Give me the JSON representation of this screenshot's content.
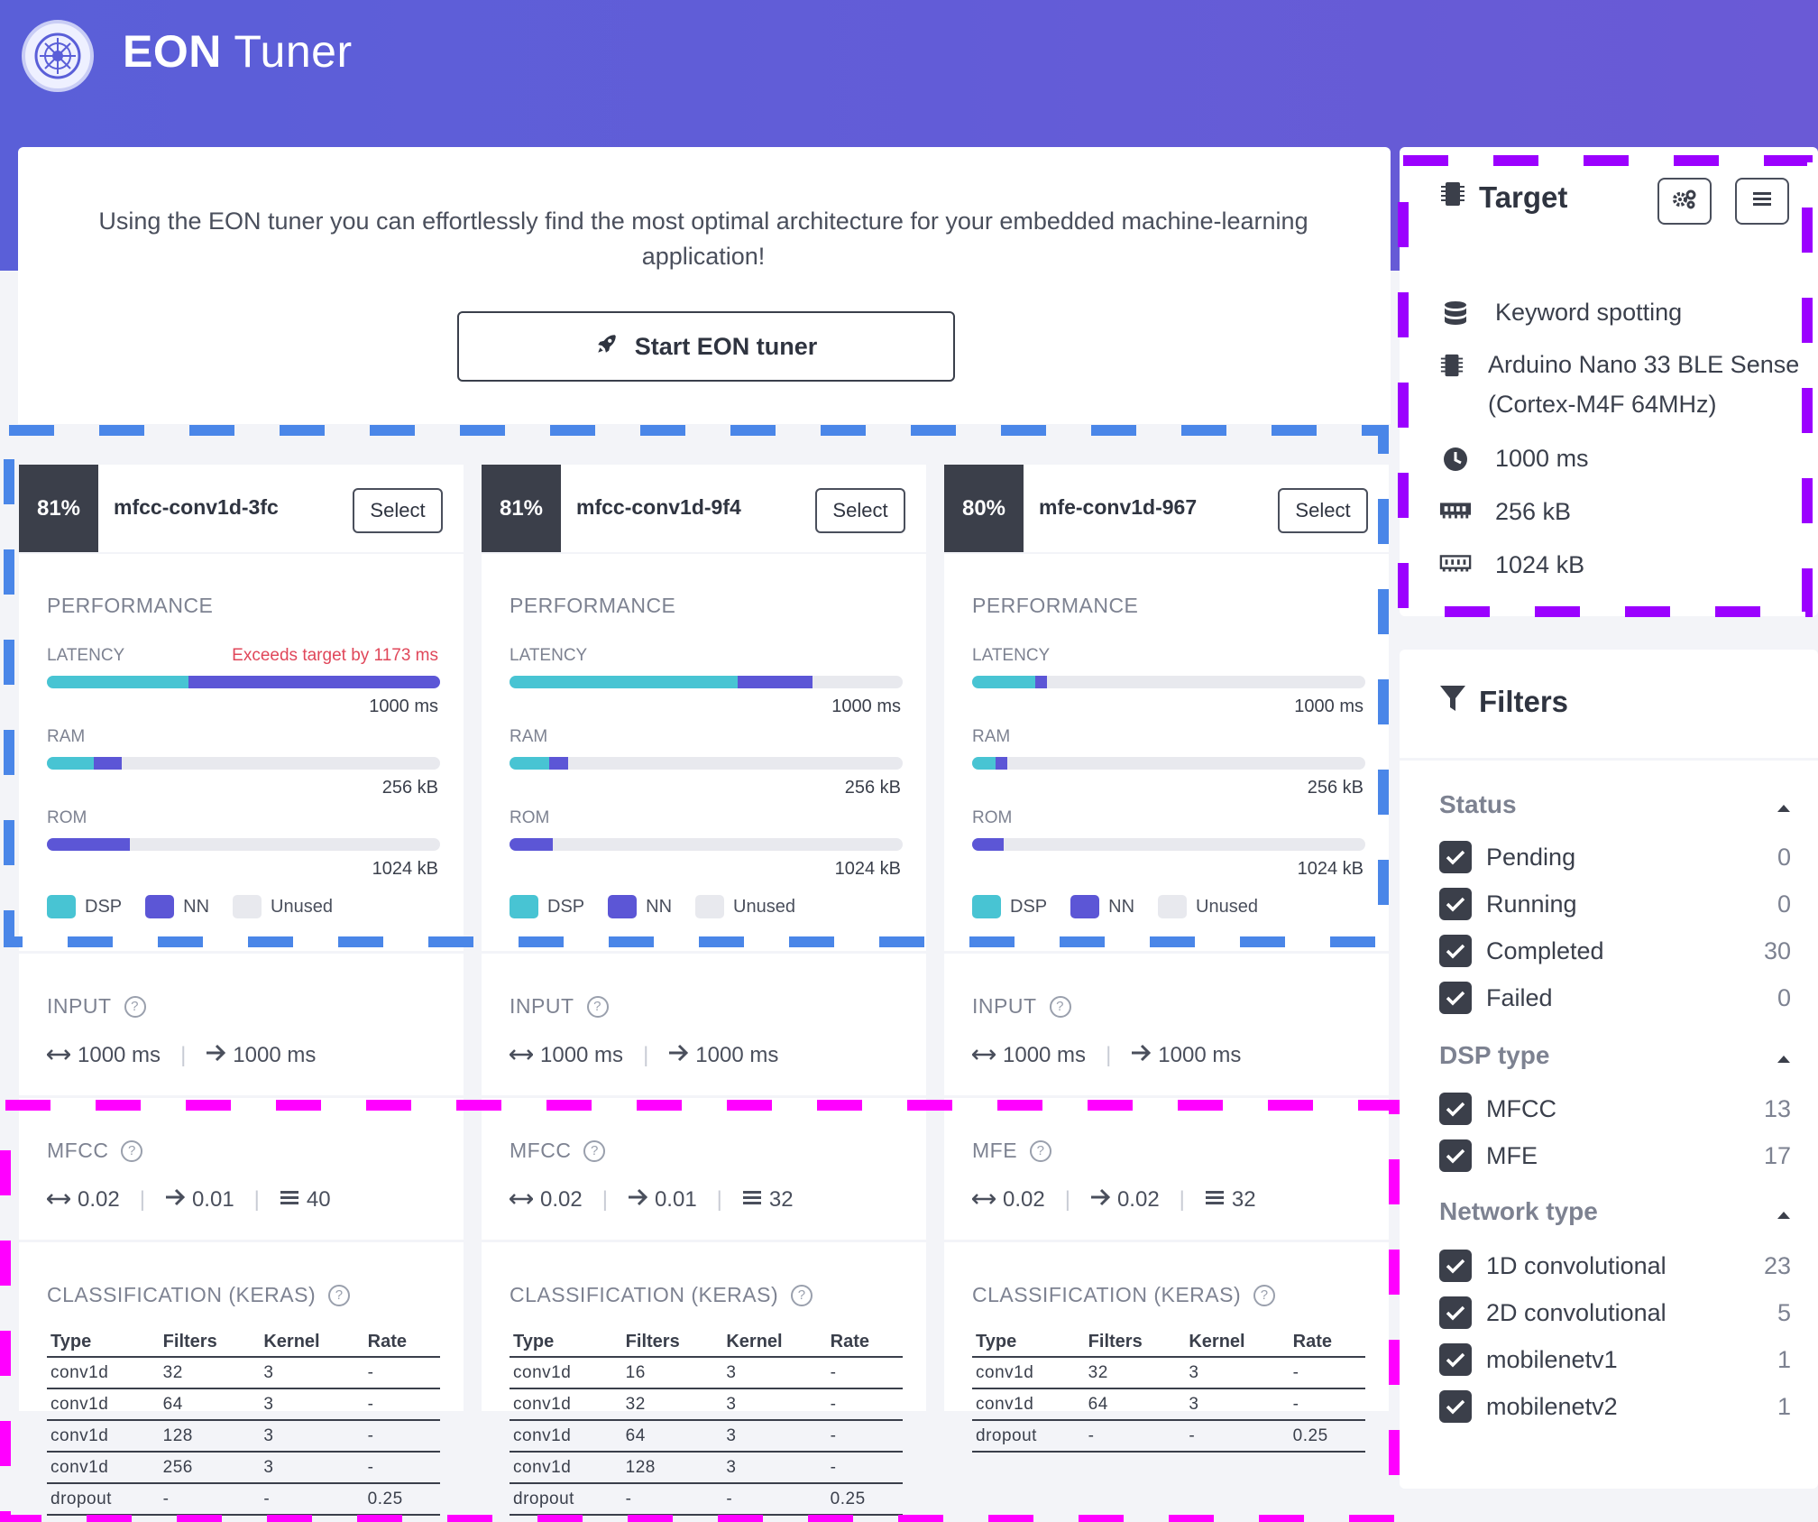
{
  "app": {
    "title_bold": "EON",
    "title_rest": " Tuner"
  },
  "intro_text": "Using the EON tuner you can effortlessly find the most optimal architecture for your embedded machine-learning application!",
  "start_button": "Start EON tuner",
  "colors": {
    "dsp": "#48c4d3",
    "nn": "#5c56d6",
    "unused": "#e8e9ee",
    "warn": "#e0475a",
    "header": "#5a5fd8"
  },
  "models": [
    {
      "score": "81%",
      "name": "mfcc-conv1d-3fc",
      "select": "Select",
      "perf_title": "PERFORMANCE",
      "latency_label": "LATENCY",
      "latency_warn": "Exceeds target by 1173 ms",
      "latency": {
        "dsp": 0.36,
        "nn": 0.64,
        "target": "1000 ms"
      },
      "ram_label": "RAM",
      "ram": {
        "dsp": 0.12,
        "nn": 0.07,
        "target": "256 kB"
      },
      "rom_label": "ROM",
      "rom": {
        "dsp": 0.0,
        "nn": 0.21,
        "target": "1024 kB"
      },
      "legend": {
        "dsp": "DSP",
        "nn": "NN",
        "unused": "Unused"
      },
      "input_title": "INPUT",
      "input_window": "1000 ms",
      "input_stride": "1000 ms",
      "dsp_title": "MFCC",
      "dsp_window": "0.02",
      "dsp_stride": "0.01",
      "dsp_coeffs": "40",
      "cls_title": "CLASSIFICATION (KERAS)",
      "headers": [
        "Type",
        "Filters",
        "Kernel",
        "Rate"
      ],
      "layers": [
        [
          "conv1d",
          "32",
          "3",
          "-"
        ],
        [
          "conv1d",
          "64",
          "3",
          "-"
        ],
        [
          "conv1d",
          "128",
          "3",
          "-"
        ],
        [
          "conv1d",
          "256",
          "3",
          "-"
        ],
        [
          "dropout",
          "-",
          "-",
          "0.25"
        ]
      ]
    },
    {
      "score": "81%",
      "name": "mfcc-conv1d-9f4",
      "select": "Select",
      "perf_title": "PERFORMANCE",
      "latency_label": "LATENCY",
      "latency_warn": "",
      "latency": {
        "dsp": 0.58,
        "nn": 0.19,
        "target": "1000 ms"
      },
      "ram_label": "RAM",
      "ram": {
        "dsp": 0.1,
        "nn": 0.05,
        "target": "256 kB"
      },
      "rom_label": "ROM",
      "rom": {
        "dsp": 0.0,
        "nn": 0.11,
        "target": "1024 kB"
      },
      "legend": {
        "dsp": "DSP",
        "nn": "NN",
        "unused": "Unused"
      },
      "input_title": "INPUT",
      "input_window": "1000 ms",
      "input_stride": "1000 ms",
      "dsp_title": "MFCC",
      "dsp_window": "0.02",
      "dsp_stride": "0.01",
      "dsp_coeffs": "32",
      "cls_title": "CLASSIFICATION (KERAS)",
      "headers": [
        "Type",
        "Filters",
        "Kernel",
        "Rate"
      ],
      "layers": [
        [
          "conv1d",
          "16",
          "3",
          "-"
        ],
        [
          "conv1d",
          "32",
          "3",
          "-"
        ],
        [
          "conv1d",
          "64",
          "3",
          "-"
        ],
        [
          "conv1d",
          "128",
          "3",
          "-"
        ],
        [
          "dropout",
          "-",
          "-",
          "0.25"
        ]
      ]
    },
    {
      "score": "80%",
      "name": "mfe-conv1d-967",
      "select": "Select",
      "perf_title": "PERFORMANCE",
      "latency_label": "LATENCY",
      "latency_warn": "",
      "latency": {
        "dsp": 0.16,
        "nn": 0.03,
        "target": "1000 ms"
      },
      "ram_label": "RAM",
      "ram": {
        "dsp": 0.06,
        "nn": 0.03,
        "target": "256 kB"
      },
      "rom_label": "ROM",
      "rom": {
        "dsp": 0.0,
        "nn": 0.08,
        "target": "1024 kB"
      },
      "legend": {
        "dsp": "DSP",
        "nn": "NN",
        "unused": "Unused"
      },
      "input_title": "INPUT",
      "input_window": "1000 ms",
      "input_stride": "1000 ms",
      "dsp_title": "MFE",
      "dsp_window": "0.02",
      "dsp_stride": "0.02",
      "dsp_coeffs": "32",
      "cls_title": "CLASSIFICATION (KERAS)",
      "headers": [
        "Type",
        "Filters",
        "Kernel",
        "Rate"
      ],
      "layers": [
        [
          "conv1d",
          "32",
          "3",
          "-"
        ],
        [
          "conv1d",
          "64",
          "3",
          "-"
        ],
        [
          "dropout",
          "-",
          "-",
          "0.25"
        ]
      ]
    }
  ],
  "target": {
    "title": "Target",
    "items": [
      {
        "icon": "database-icon",
        "text": "Keyword spotting"
      },
      {
        "icon": "chip-icon",
        "text": "Arduino Nano 33 BLE Sense (Cortex-M4F 64MHz)"
      },
      {
        "icon": "clock-icon",
        "text": "1000 ms"
      },
      {
        "icon": "memory-icon",
        "text": "256 kB"
      },
      {
        "icon": "memory-outline-icon",
        "text": "1024 kB"
      }
    ]
  },
  "filters": {
    "title": "Filters",
    "groups": [
      {
        "title": "Status",
        "items": [
          {
            "label": "Pending",
            "count": "0"
          },
          {
            "label": "Running",
            "count": "0"
          },
          {
            "label": "Completed",
            "count": "30"
          },
          {
            "label": "Failed",
            "count": "0"
          }
        ]
      },
      {
        "title": "DSP type",
        "items": [
          {
            "label": "MFCC",
            "count": "13"
          },
          {
            "label": "MFE",
            "count": "17"
          }
        ]
      },
      {
        "title": "Network type",
        "items": [
          {
            "label": "1D convolutional",
            "count": "23"
          },
          {
            "label": "2D convolutional",
            "count": "5"
          },
          {
            "label": "mobilenetv1",
            "count": "1"
          },
          {
            "label": "mobilenetv2",
            "count": "1"
          }
        ]
      }
    ]
  }
}
